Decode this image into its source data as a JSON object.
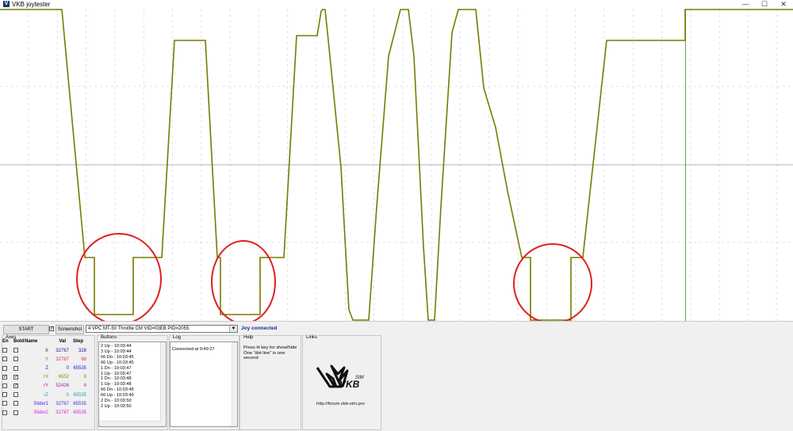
{
  "window": {
    "title": "VKB joytester",
    "icon": "vkb-app-icon",
    "minimize": "—",
    "maximize": "☐",
    "close": "✕"
  },
  "toolbar": {
    "start_label": "START",
    "screenshot_label": "Screenshot",
    "screenshot_checked": true,
    "device": "4 VPC MT-50 Throttle CM VID=03EB PID=2055",
    "status": "Joy connected",
    "status_color": "#1a2a9a"
  },
  "axes": {
    "group_label": "Axes",
    "headers": {
      "en": "En",
      "bold": "Bold",
      "name": "Name",
      "val": "Val",
      "step": "Step"
    },
    "rows": [
      {
        "name": "X",
        "val": "32767",
        "step": "328",
        "en": false,
        "bold": false,
        "color": "#1a1a8a"
      },
      {
        "name": "Y",
        "val": "32767",
        "step": "68",
        "en": false,
        "bold": false,
        "color": "#e0303a"
      },
      {
        "name": "Z",
        "val": "0",
        "step": "65535",
        "en": false,
        "bold": false,
        "color": "#1a1ae0"
      },
      {
        "name": "rX",
        "val": "6552",
        "step": "8",
        "en": true,
        "bold": true,
        "color": "#8a8a10"
      },
      {
        "name": "rY",
        "val": "52426",
        "step": "4",
        "en": false,
        "bold": true,
        "color": "#9a20a0"
      },
      {
        "name": "rZ",
        "val": "0",
        "step": "65535",
        "en": false,
        "bold": false,
        "color": "#20a0a0"
      },
      {
        "name": "Slider1",
        "val": "32767",
        "step": "65535",
        "en": false,
        "bold": false,
        "color": "#4a2ae0"
      },
      {
        "name": "Slider2",
        "val": "32767",
        "step": "65535",
        "en": false,
        "bold": false,
        "color": "#e020e0"
      }
    ]
  },
  "buttons_panel": {
    "label": "Buttons",
    "items": [
      "2 Up - 10:03:44",
      "3 Up - 10:03:44",
      "66 Dn - 10:03:45",
      "66 Up - 10:03:45",
      "1 Dn - 10:03:47",
      "1 Up - 10:03:47",
      "1 Dn - 10:03:48",
      "1 Up - 10:03:48",
      "66 Dn - 10:03:49",
      "66 Up - 10:03:49",
      "2 Dn - 10:03:50",
      "2 Up - 10:03:50"
    ]
  },
  "log_panel": {
    "label": "Log",
    "text": "Connected at 9:49:27"
  },
  "help_panel": {
    "label": "Help",
    "line1": "Press H key for show/hide",
    "line2": "One \"dot line\" is one second"
  },
  "links_panel": {
    "label": "Links",
    "logo_text": "VKB",
    "logo_sup": "SIM",
    "url": "http://forum.vkb-sim.pro"
  },
  "chart": {
    "trace_color": "#7a7a00",
    "marker_color": "#2a9a2a",
    "highlight_color": "#e02020"
  }
}
